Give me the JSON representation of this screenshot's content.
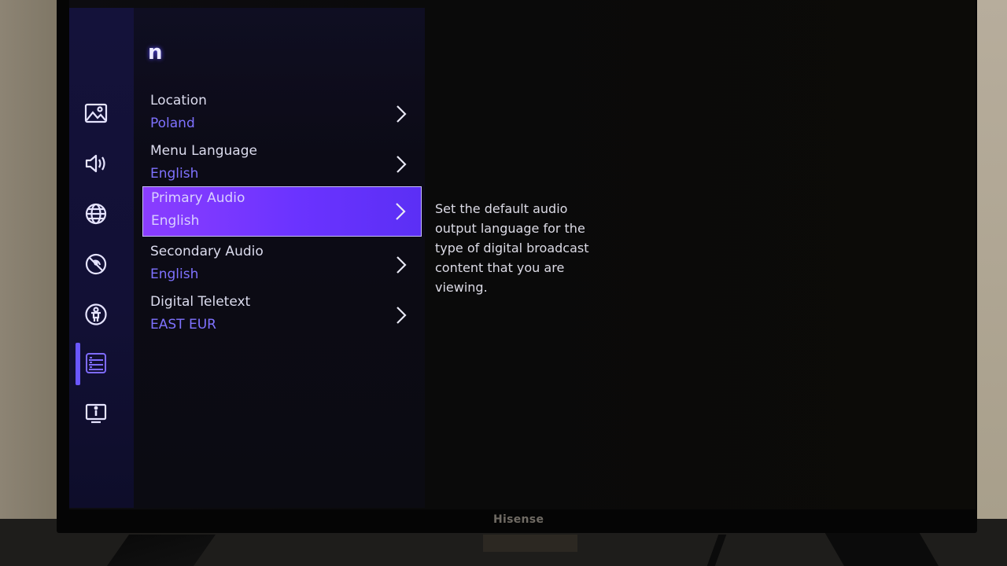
{
  "panel": {
    "title_fragment": "n"
  },
  "sidebar": {
    "items": [
      {
        "icon": "picture-icon",
        "label": "Picture",
        "active": false
      },
      {
        "icon": "sound-icon",
        "label": "Sound",
        "active": false
      },
      {
        "icon": "network-globe-icon",
        "label": "Network",
        "active": false
      },
      {
        "icon": "channel-signal-icon",
        "label": "Channels",
        "active": false
      },
      {
        "icon": "accessibility-icon",
        "label": "Accessibility",
        "active": false
      },
      {
        "icon": "system-list-icon",
        "label": "System",
        "active": true
      },
      {
        "icon": "support-info-icon",
        "label": "Support",
        "active": false
      }
    ]
  },
  "menu": {
    "items": [
      {
        "label": "Location",
        "value": "Poland",
        "selected": false
      },
      {
        "label": "Menu Language",
        "value": "English",
        "selected": false
      },
      {
        "label": "Primary Audio",
        "value": "English",
        "selected": true
      },
      {
        "label": "Secondary Audio",
        "value": "English",
        "selected": false
      },
      {
        "label": "Digital Teletext",
        "value": "EAST EUR",
        "selected": false
      }
    ]
  },
  "description": "Set the default audio output language for the type of digital broadcast content that you are viewing.",
  "tv": {
    "brand": "Hisense"
  },
  "colors": {
    "accent": "#6a57ff",
    "selected_row": "#7a38ff",
    "value_text": "#7f72ff"
  }
}
